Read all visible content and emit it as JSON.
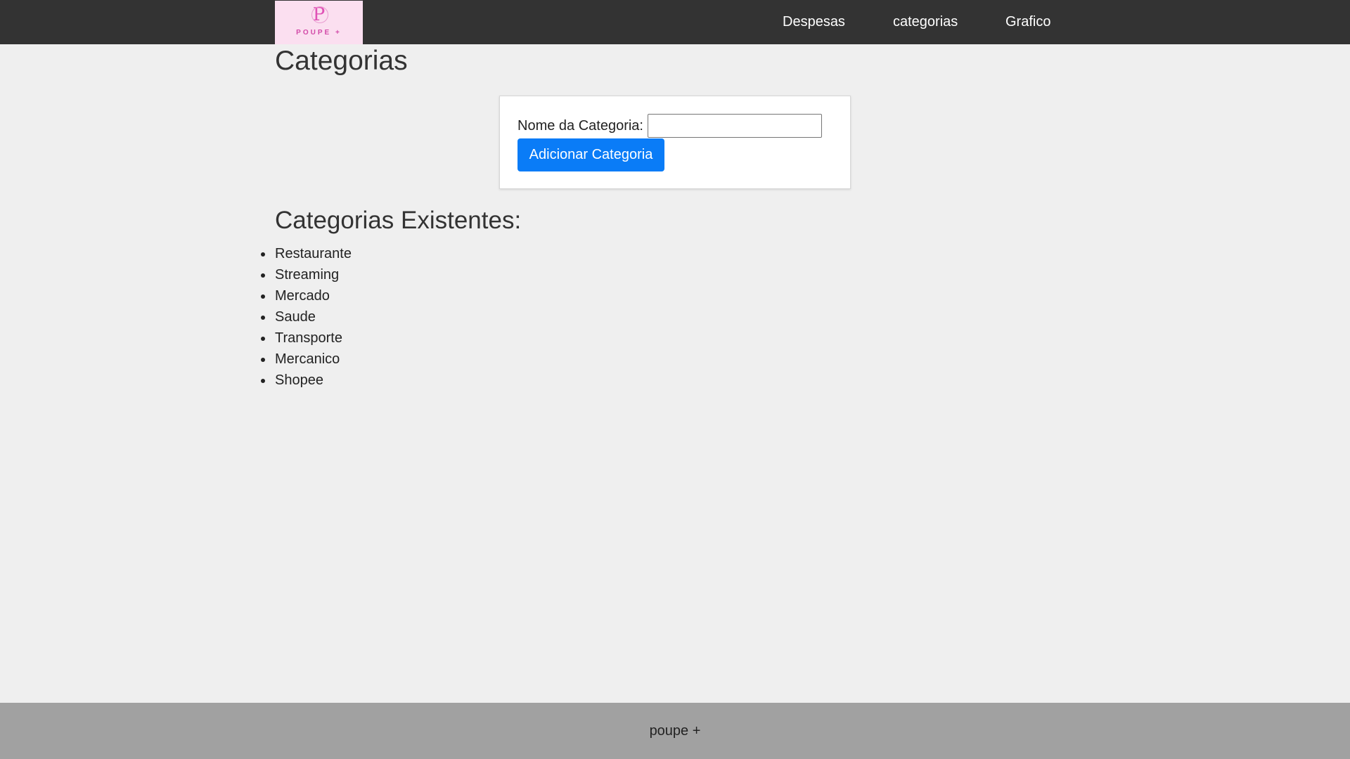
{
  "header": {
    "logo": {
      "letter": "P",
      "text": "POUPE +"
    },
    "nav": [
      {
        "label": "Despesas"
      },
      {
        "label": "categorias"
      },
      {
        "label": "Grafico"
      }
    ]
  },
  "main": {
    "title": "Categorias",
    "form": {
      "label": "Nome da Categoria:",
      "input_value": "",
      "input_placeholder": "",
      "button_label": "Adicionar Categoria"
    },
    "list_title": "Categorias Existentes:",
    "categories": [
      "Restaurante",
      "Streaming",
      "Mercado",
      "Saude",
      "Transporte",
      "Mercanico",
      "Shopee"
    ]
  },
  "footer": {
    "text": "poupe +"
  },
  "colors": {
    "topbar": "#333333",
    "background": "#efefef",
    "button": "#0a7cf7",
    "footer": "#a1a1a1",
    "logo_bg": "#fbdff0",
    "logo_accent": "#e052b6"
  }
}
